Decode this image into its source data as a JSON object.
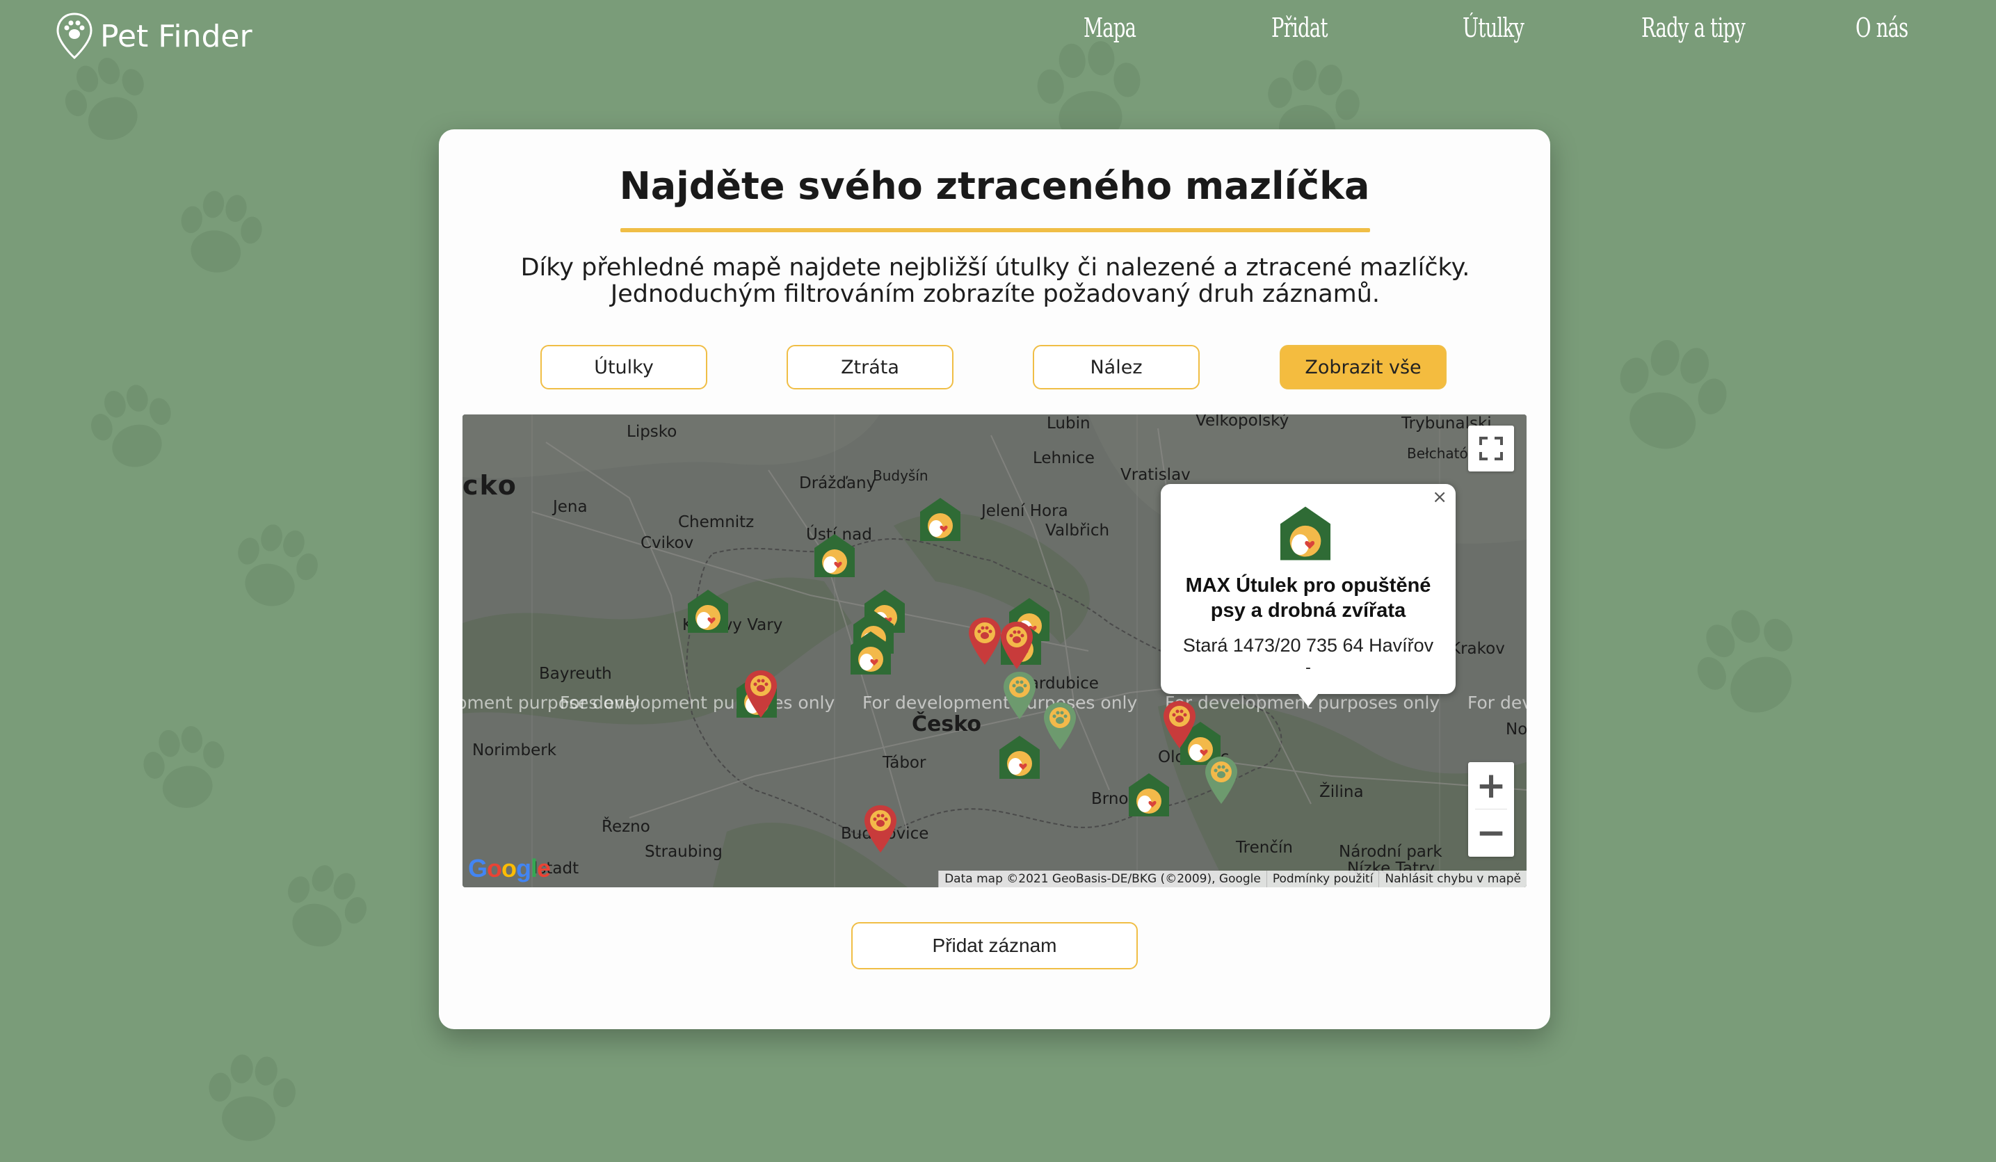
{
  "header": {
    "logo_text": "Pet Finder",
    "nav": [
      "Mapa",
      "Přidat",
      "Útulky",
      "Rady a tipy",
      "O nás"
    ]
  },
  "card": {
    "title": "Najděte svého ztraceného mazlíčka",
    "description_line1": "Díky přehledné mapě najdete nejbližší útulky či nalezené a ztracené mazlíčky.",
    "description_line2": "Jednoduchým filtrováním zobrazíte požadovaný druh záznamů.",
    "filters": [
      "Útulky",
      "Ztráta",
      "Nález",
      "Zobrazit vše"
    ],
    "active_filter": "Zobrazit vše",
    "add_button": "Přidat záznam"
  },
  "map": {
    "labels": {
      "lipsko": "Lipsko",
      "lubin": "Lubin",
      "velkopolsky": "Velkopolský",
      "trybunalski": "Trybunalski",
      "belchatow": "Bełchatów",
      "drazdany": "Drážďany",
      "budysin": "Budyšín",
      "lehnice": "Lehnice",
      "vratislav": "Vratislav",
      "jena": "Jena",
      "chemnitz": "Chemnitz",
      "jelenia": "Jelení Hora",
      "valbrich": "Valbřich",
      "cvikov": "Cvikov",
      "ustinad": "Ústí nad",
      "karlovy": "Karlovy Vary",
      "bayreuth": "Bayreuth",
      "pardubice": "Pardubice",
      "cesko": "Česko",
      "norimberk": "Norimberk",
      "tabor": "Tábor",
      "olomouc": "Olomouc",
      "brno": "Brno",
      "zilina": "Žilina",
      "rezno": "Řezno",
      "straubing": "Straubing",
      "budejovice": "Budějovice",
      "trencin": "Trenčín",
      "narodni": "Národní park",
      "nizke": "Nízke Tatry",
      "krakov": "Krakov",
      "no": "No",
      "istadt": "lstadt",
      "cko": "cko"
    },
    "watermark": "For development purposes only",
    "attribution": [
      "Data map ©2021 GeoBasis-DE/BKG (©2009), Google",
      "Podmínky použití",
      "Nahlásit chybu v mapě"
    ],
    "google_logo": "Google",
    "controls": {
      "zoom_in": "+",
      "zoom_out": "−"
    },
    "info_window": {
      "title": "MAX Útulek pro opuštěné psy a drobná zvířata",
      "address": "Stará 1473/20 735 64 Havířov",
      "extra": "-",
      "close": "×"
    },
    "colors": {
      "shelter": "#2f6b35",
      "lost": "#c83b3b",
      "found": "#6d9a6e",
      "accent": "#f0be46"
    }
  }
}
